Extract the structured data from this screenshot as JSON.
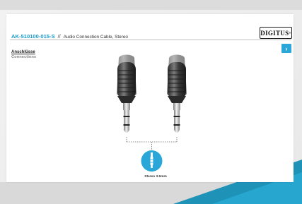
{
  "brand": {
    "logo_text": "DIGITUS",
    "registered": "®"
  },
  "header": {
    "model": "AK-510100-015-S",
    "separator": "//",
    "description": "Audio Connection Cable, Stereo"
  },
  "section": {
    "title_de": "Anschlüsse",
    "title_en": "Connections"
  },
  "connector": {
    "label": "Stereo 3.5mm"
  },
  "nav": {
    "next_icon": "chevron-right-icon"
  },
  "colors": {
    "accent": "#1a9ccf",
    "teal": "#2aa7d8"
  }
}
